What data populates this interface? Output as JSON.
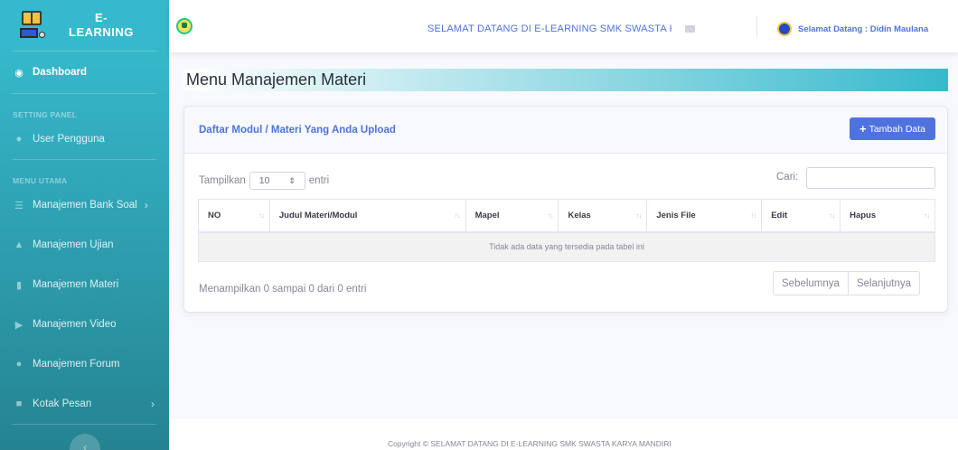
{
  "sidebar": {
    "brand_line1": "E-",
    "brand_line2": "LEARNING",
    "dashboard": "Dashboard",
    "heading_setting": "SETTING PANEL",
    "user_pengguna": "User Pengguna",
    "heading_menu": "MENU UTAMA",
    "items": [
      {
        "label": "Manajemen Bank Soal",
        "icon": "list-icon",
        "has_chevron": true
      },
      {
        "label": "Manajemen Ujian",
        "icon": "pin-icon",
        "has_chevron": false
      },
      {
        "label": "Manajemen Materi",
        "icon": "book-icon",
        "has_chevron": false
      },
      {
        "label": "Manajemen Video",
        "icon": "video-icon",
        "has_chevron": false
      },
      {
        "label": "Manajemen Forum",
        "icon": "users-icon",
        "has_chevron": false
      },
      {
        "label": "Kotak Pesan",
        "icon": "message-icon",
        "has_chevron": true
      }
    ],
    "chevron": "›",
    "toggle": "‹"
  },
  "topbar": {
    "welcome": "SELAMAT DATANG DI E-LEARNING SMK SWASTA KARYA MANDIRI",
    "user": "Selamat Datang : Didin Maulana"
  },
  "page": {
    "title": "Menu Manajemen Materi"
  },
  "card": {
    "title": "Daftar Modul / Materi Yang Anda Upload",
    "add_button": "Tambah Data",
    "show_prefix": "Tampilkan",
    "show_value": "10",
    "show_suffix": "entri",
    "search_label": "Cari:",
    "columns": [
      "NO",
      "Judul Materi/Modul",
      "Mapel",
      "Kelas",
      "Jenis File",
      "Edit",
      "Hapus"
    ],
    "empty_message": "Tidak ada data yang tersedia pada tabel ini",
    "info": "Menampilkan 0 sampai 0 dari 0 entri",
    "prev": "Sebelumnya",
    "next": "Selanjutnya"
  },
  "footer": {
    "text": "Copyright © SELAMAT DATANG DI E-LEARNING SMK SWASTA KARYA MANDIRI"
  },
  "colors": {
    "sidebar_top": "#36b9cc",
    "sidebar_bottom": "#258391",
    "primary": "#4e73df"
  }
}
